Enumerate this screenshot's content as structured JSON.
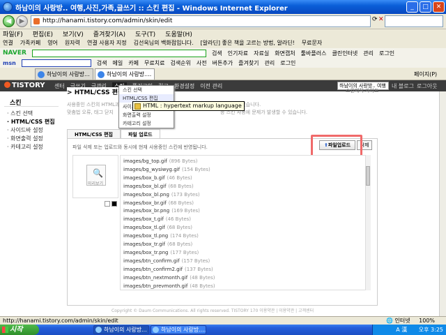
{
  "window": {
    "title": "하남이의 사랑방.. 여행,사진,가족,글쓰기 :: 스킨 편집 - Windows Internet Explorer"
  },
  "address": {
    "url": "http://hanami.tistory.com/admin/skin/edit"
  },
  "menu": [
    "파일(F)",
    "편집(E)",
    "보기(V)",
    "즐겨찾기(A)",
    "도구(T)",
    "도움말(H)"
  ],
  "links_bar": {
    "label": "연결",
    "items": [
      "가족카페",
      "영어",
      "원자력",
      "연결 사용자 지정",
      "김선옥님의 백화점입니다.",
      "[알라딘] 좋은 책을 고르는 방법, 알라딘!",
      "무료문자"
    ]
  },
  "naver_bar": {
    "logo": "NAVER",
    "search_label": "검색",
    "items": [
      "인기자료",
      "자료실",
      "화면캡처",
      "툴바플러스",
      "클린인터넷",
      "관리",
      "로그인"
    ]
  },
  "msn_bar": {
    "logo": "msn",
    "search_label": "검색",
    "items": [
      "메일",
      "카페",
      "무료치료",
      "검색순위",
      "사전",
      "버튼추가",
      "즐겨찾기",
      "관리",
      "로그인"
    ]
  },
  "tabs": [
    "하남이의 사랑방...",
    "하남이의 사랑방...."
  ],
  "toolbar_right": [
    "페이지(P)"
  ],
  "tistory": {
    "logo": "TISTORY",
    "nav": [
      "센터",
      "글쓰기",
      "글관리",
      "스킨",
      "플러그인",
      "링크",
      "환경설정",
      "이전 관리"
    ],
    "active_nav": "스킨",
    "blog_select": "하남이의 사랑방.. 여행",
    "right": [
      "내 블로그",
      "로그아웃"
    ]
  },
  "sidebar": {
    "title": "스킨",
    "items": [
      "스킨 선택",
      "HTML/CSS 편집",
      "사이드바 설정",
      "화면출력 설정",
      "카테고리 설정"
    ],
    "active_index": 1
  },
  "main": {
    "title": "HTML/CSS 편집",
    "guide_link": "스킨제작 가이드",
    "desc1": "사용중인 스킨의 HTML과",
    "desc1b": "맞춤법 오류, 태그 닫지",
    "desc2": "수정할 수 있습니다.",
    "desc2b": "등 스킨 사용에 문제가 발생할 수 있습니다.",
    "panel_tabs": [
      "HTML/CSS 편집",
      "파일 업로드"
    ],
    "panel_desc": "파일 삭제 또는 업로드와 동시에 현재 사용중인 스킨에 반영됩니다.",
    "upload_label": "파일업로드",
    "delete_label": "삭제",
    "preview_label": "미리보기",
    "files": [
      {
        "name": "images/bg_top.gif",
        "size": "(896 Bytes)"
      },
      {
        "name": "images/bg_wysiwyg.gif",
        "size": "(154 Bytes)"
      },
      {
        "name": "images/box_b.gif",
        "size": "(46 Bytes)"
      },
      {
        "name": "images/box_bl.gif",
        "size": "(68 Bytes)"
      },
      {
        "name": "images/box_bl.png",
        "size": "(173 Bytes)"
      },
      {
        "name": "images/box_br.gif",
        "size": "(68 Bytes)"
      },
      {
        "name": "images/box_br.png",
        "size": "(169 Bytes)"
      },
      {
        "name": "images/box_t.gif",
        "size": "(46 Bytes)"
      },
      {
        "name": "images/box_tl.gif",
        "size": "(68 Bytes)"
      },
      {
        "name": "images/box_tl.png",
        "size": "(174 Bytes)"
      },
      {
        "name": "images/box_tr.gif",
        "size": "(68 Bytes)"
      },
      {
        "name": "images/box_tr.png",
        "size": "(177 Bytes)"
      },
      {
        "name": "images/btn_confirm.gif",
        "size": "(157 Bytes)"
      },
      {
        "name": "images/btn_confirm2.gif",
        "size": "(137 Bytes)"
      },
      {
        "name": "images/btn_nextmonth.gif",
        "size": "(48 Bytes)"
      },
      {
        "name": "images/btn_prevmonth.gif",
        "size": "(48 Bytes)"
      }
    ]
  },
  "dropdown": {
    "items": [
      "스킨 선택",
      "HTML/CSS 편집",
      "사이드바 설정",
      "화면출력 설정",
      "카테고리 설정"
    ],
    "highlighted": 1
  },
  "tooltip": {
    "text": "HTML : hypertext markup language"
  },
  "footer": {
    "text": "Copyright © Daum Communications. All rights reserved.  TISTORY 170  이용약관 | 이용약관 | 고객센터"
  },
  "statusbar": {
    "text": "http://hanami.tistory.com/admin/skin/edit",
    "zone": "인터넷",
    "zoom": "100%"
  },
  "taskbar": {
    "start": "시작",
    "tasks": [
      "하남이의 사랑방...",
      "하남이의 사랑방...."
    ],
    "clock": "오후 3:25",
    "ime": "A 漢"
  },
  "colors": {
    "tistory_bar": "#3b3b3b",
    "tistory_accent": "#f15a22",
    "highlight_box": "#f06a6a",
    "xp_blue": "#245edb"
  }
}
